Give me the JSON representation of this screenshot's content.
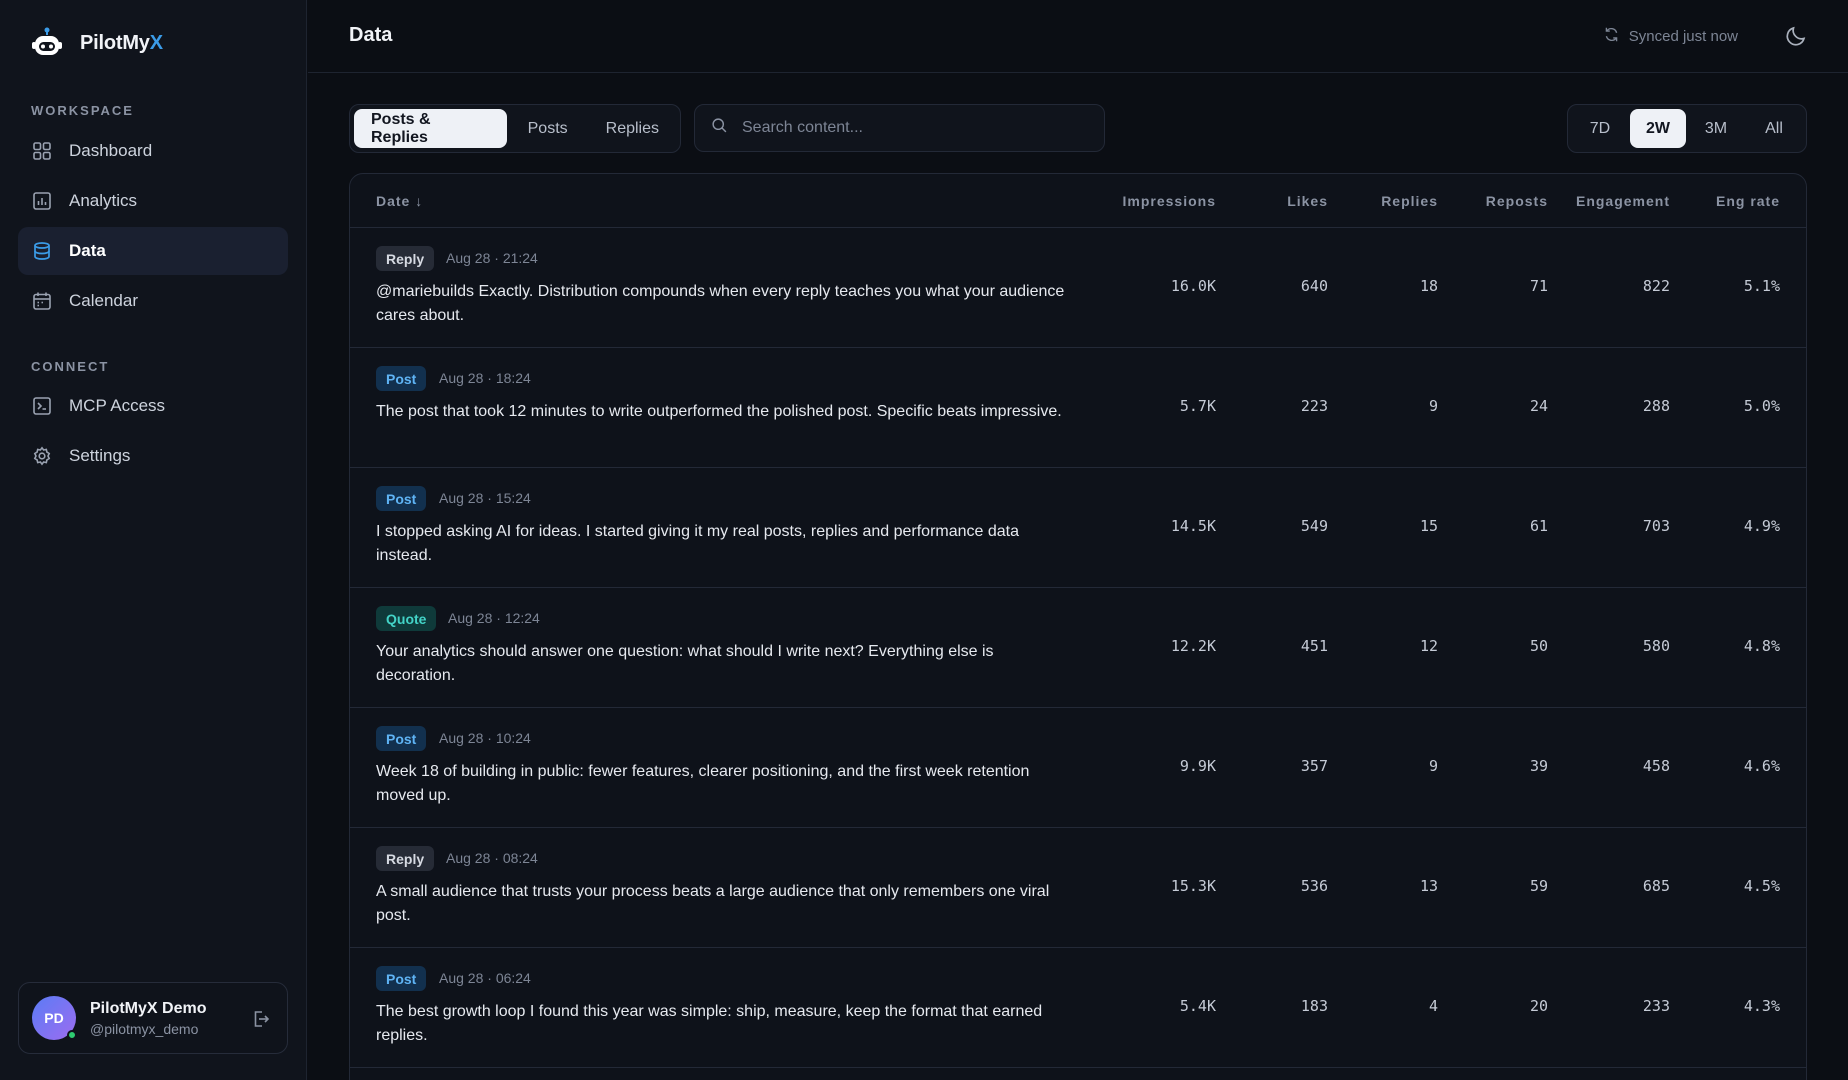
{
  "brand": {
    "name_main": "PilotMy",
    "name_accent": "X"
  },
  "sidebar": {
    "workspace_label": "WORKSPACE",
    "connect_label": "CONNECT",
    "items": [
      {
        "label": "Dashboard",
        "icon": "dashboard-icon"
      },
      {
        "label": "Analytics",
        "icon": "analytics-icon"
      },
      {
        "label": "Data",
        "icon": "database-icon",
        "active": true
      },
      {
        "label": "Calendar",
        "icon": "calendar-icon"
      },
      {
        "label": "MCP Access",
        "icon": "terminal-icon"
      },
      {
        "label": "Settings",
        "icon": "gear-icon"
      }
    ]
  },
  "user": {
    "initials": "PD",
    "name": "PilotMyX Demo",
    "handle": "@pilotmyx_demo"
  },
  "header": {
    "title": "Data",
    "sync_status": "Synced just now"
  },
  "filters": {
    "tabs": [
      "Posts & Replies",
      "Posts",
      "Replies"
    ],
    "active_tab": "Posts & Replies",
    "search_placeholder": "Search content...",
    "ranges": [
      "7D",
      "2W",
      "3M",
      "All"
    ],
    "active_range": "2W"
  },
  "table": {
    "columns": [
      "Date ↓",
      "Impressions",
      "Likes",
      "Replies",
      "Reposts",
      "Engagement",
      "Eng rate"
    ],
    "rows": [
      {
        "type": "Reply",
        "date": "Aug 28 · 21:24",
        "text": "@mariebuilds Exactly. Distribution compounds when every reply teaches you what your audience cares about.",
        "impressions": "16.0K",
        "likes": "640",
        "replies": "18",
        "reposts": "71",
        "engagement": "822",
        "eng_rate": "5.1%"
      },
      {
        "type": "Post",
        "date": "Aug 28 · 18:24",
        "text": "The post that took 12 minutes to write outperformed the polished post. Specific beats impressive.",
        "impressions": "5.7K",
        "likes": "223",
        "replies": "9",
        "reposts": "24",
        "engagement": "288",
        "eng_rate": "5.0%"
      },
      {
        "type": "Post",
        "date": "Aug 28 · 15:24",
        "text": "I stopped asking AI for ideas. I started giving it my real posts, replies and performance data instead.",
        "impressions": "14.5K",
        "likes": "549",
        "replies": "15",
        "reposts": "61",
        "engagement": "703",
        "eng_rate": "4.9%"
      },
      {
        "type": "Quote",
        "date": "Aug 28 · 12:24",
        "text": "Your analytics should answer one question: what should I write next? Everything else is decoration.",
        "impressions": "12.2K",
        "likes": "451",
        "replies": "12",
        "reposts": "50",
        "engagement": "580",
        "eng_rate": "4.8%"
      },
      {
        "type": "Post",
        "date": "Aug 28 · 10:24",
        "text": "Week 18 of building in public: fewer features, clearer positioning, and the first week retention moved up.",
        "impressions": "9.9K",
        "likes": "357",
        "replies": "9",
        "reposts": "39",
        "engagement": "458",
        "eng_rate": "4.6%"
      },
      {
        "type": "Reply",
        "date": "Aug 28 · 08:24",
        "text": "A small audience that trusts your process beats a large audience that only remembers one viral post.",
        "impressions": "15.3K",
        "likes": "536",
        "replies": "13",
        "reposts": "59",
        "engagement": "685",
        "eng_rate": "4.5%"
      },
      {
        "type": "Post",
        "date": "Aug 28 · 06:24",
        "text": "The best growth loop I found this year was simple: ship, measure, keep the format that earned replies.",
        "impressions": "5.4K",
        "likes": "183",
        "replies": "4",
        "reposts": "20",
        "engagement": "233",
        "eng_rate": "4.3%"
      }
    ]
  },
  "colors": {
    "accent": "#3b9ce8",
    "background": "#0b0e14",
    "sidebar": "#10141c"
  }
}
